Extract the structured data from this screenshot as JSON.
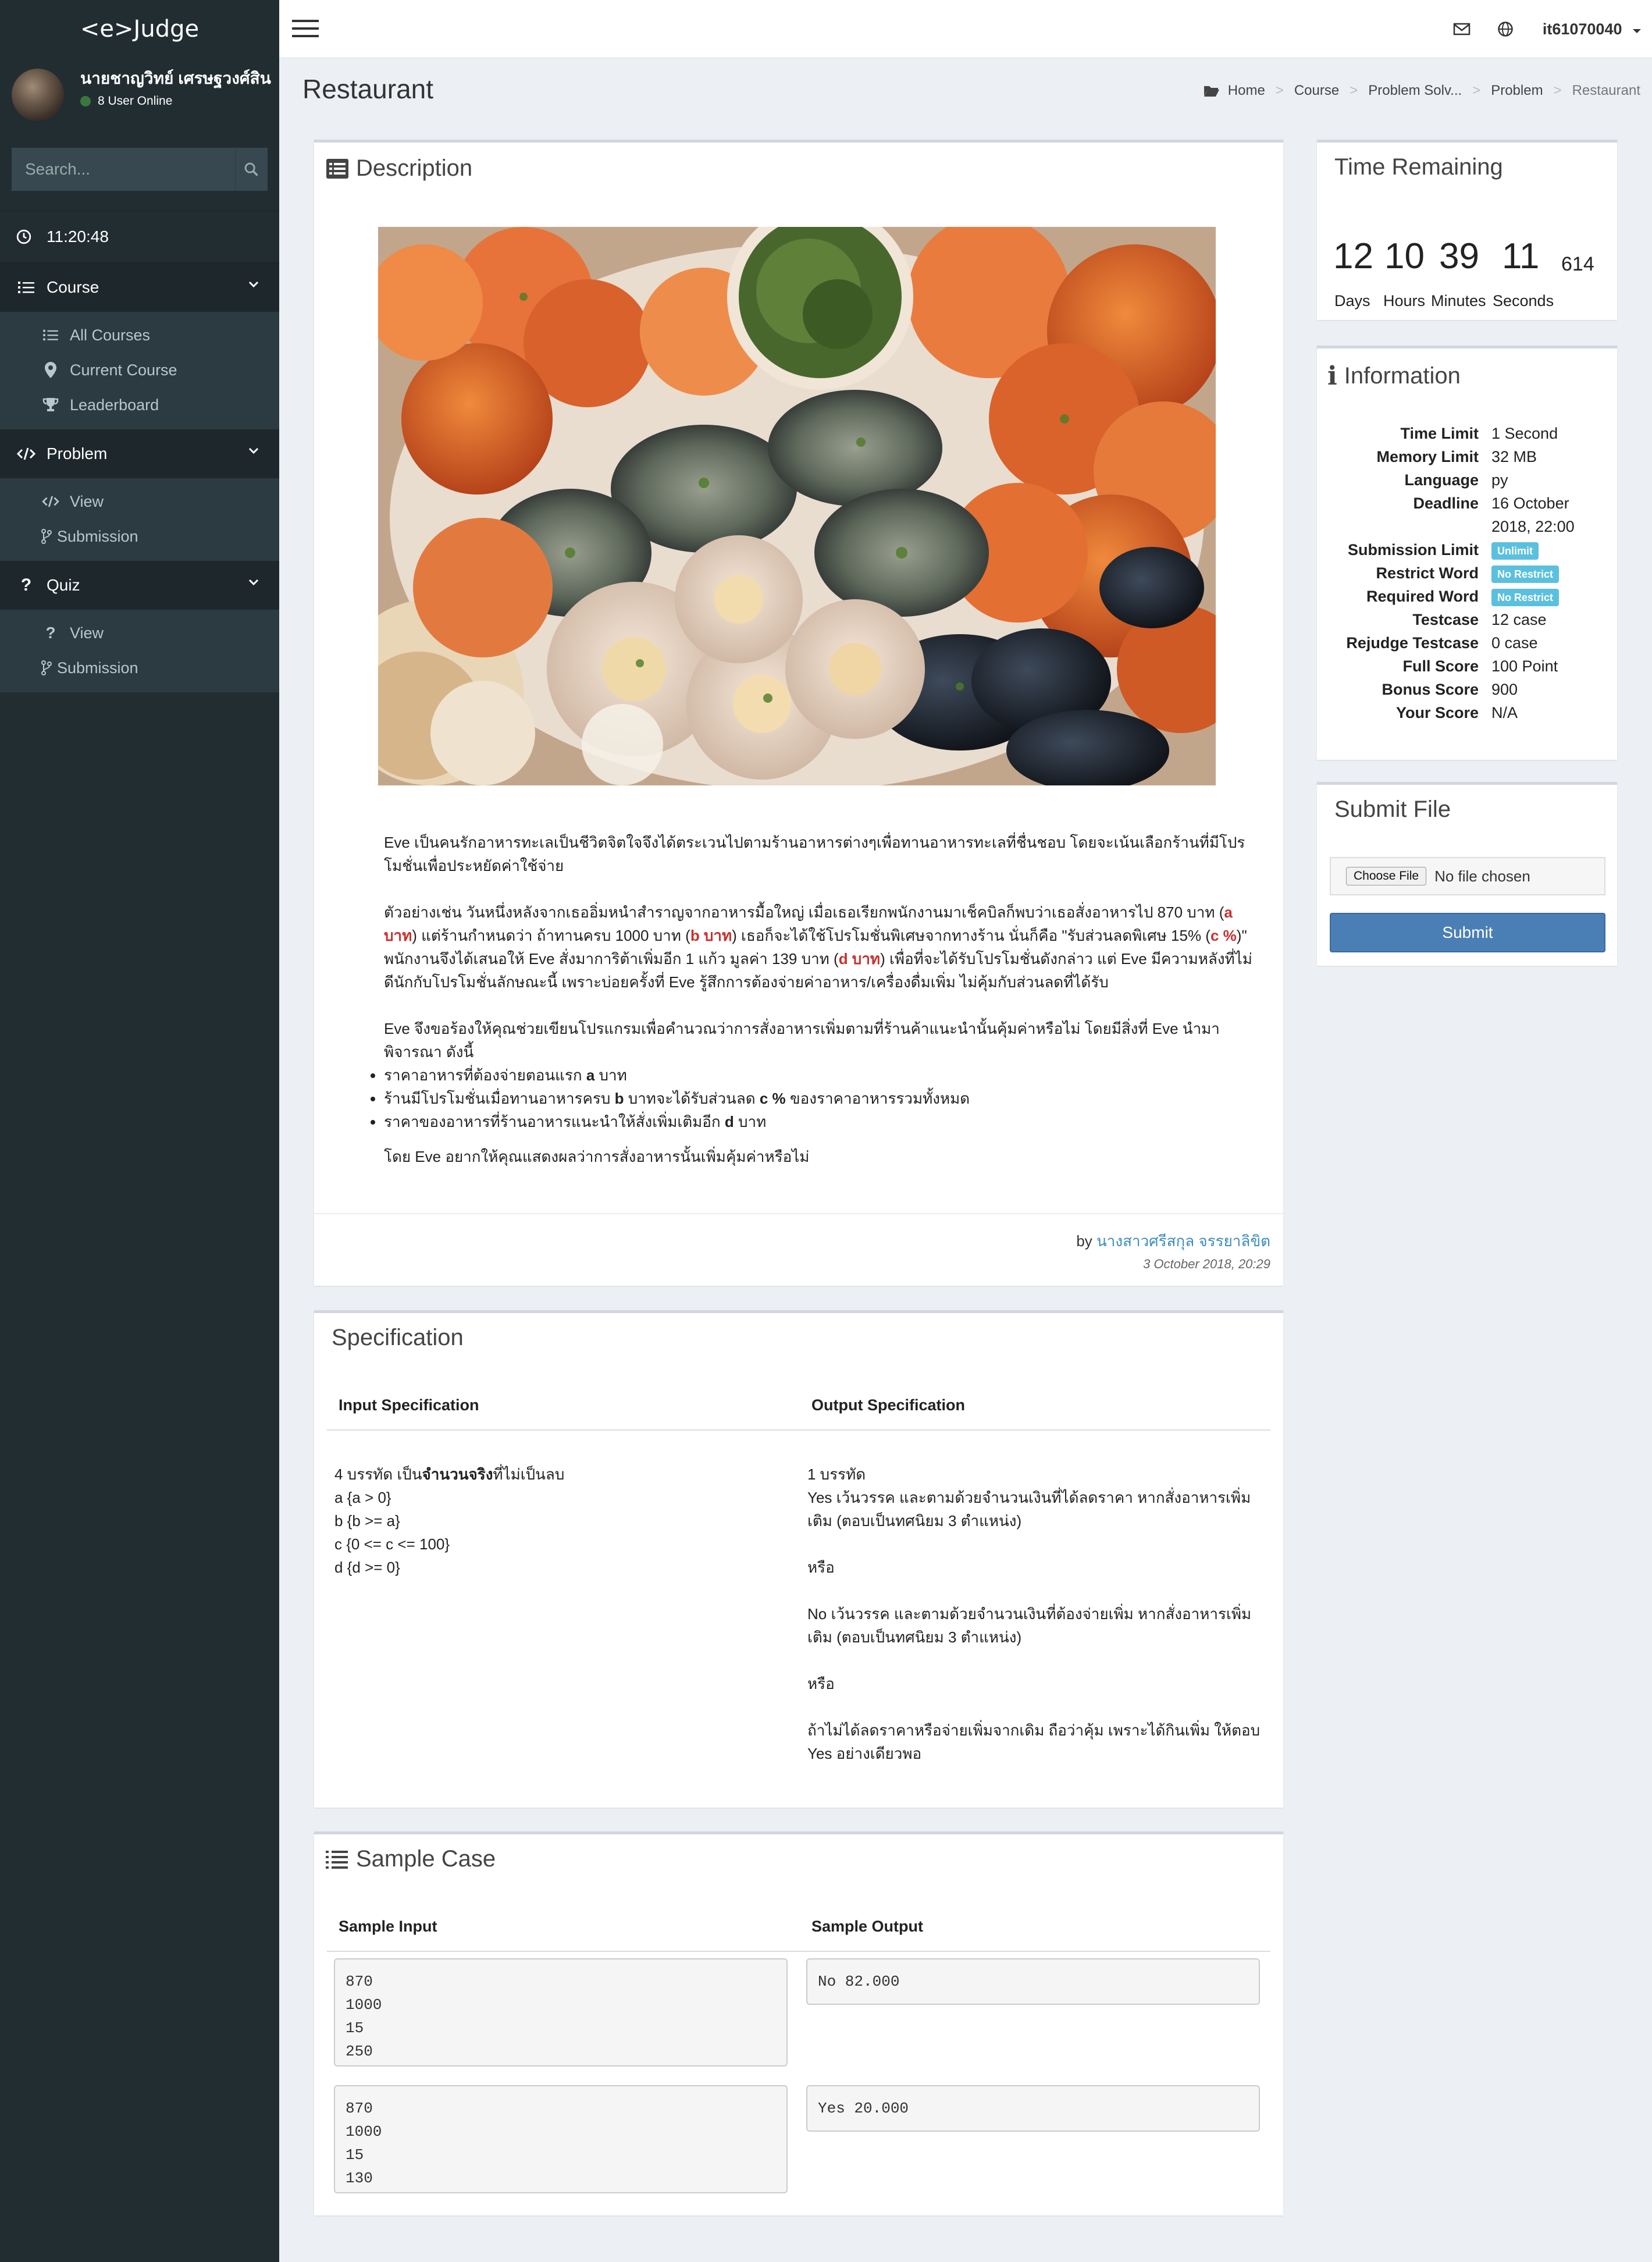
{
  "app": {
    "brand": "<e>Judge"
  },
  "sidebar": {
    "user_name": "นายชาญวิทย์ เศรษฐวงศ์สิน",
    "online": "8 User Online",
    "search_placeholder": "Search...",
    "clock": "11:20:48",
    "sections": [
      {
        "label": "Course",
        "icon": "list-icon",
        "items": [
          {
            "label": "All Courses",
            "icon": "list-icon"
          },
          {
            "label": "Current Course",
            "icon": "map-marker-icon"
          },
          {
            "label": "Leaderboard",
            "icon": "trophy-icon"
          }
        ]
      },
      {
        "label": "Problem",
        "icon": "code-icon",
        "items": [
          {
            "label": "View",
            "icon": "code-icon"
          },
          {
            "label": "Submission",
            "icon": "code-fork-icon"
          }
        ]
      },
      {
        "label": "Quiz",
        "icon": "question-icon",
        "items": [
          {
            "label": "View",
            "icon": "question-icon"
          },
          {
            "label": "Submission",
            "icon": "code-fork-icon"
          }
        ]
      }
    ]
  },
  "topbar": {
    "username": "it61070040"
  },
  "page": {
    "title": "Restaurant",
    "breadcrumb": [
      "Home",
      "Course",
      "Problem Solv...",
      "Problem",
      "Restaurant"
    ]
  },
  "description": {
    "title": "Description",
    "p1": "Eve เป็นคนรักอาหารทะเลเป็นชีวิตจิตใจจึงได้ตระเวนไปตามร้านอาหารต่างๆเพื่อทานอาหารทะเลที่ชื่นชอบ โดยจะเน้นเลือกร้านที่มีโปรโมชั่นเพื่อประหยัดค่าใช้จ่าย",
    "p2_a": "ตัวอย่างเช่น วันหนึ่งหลังจากเธออิ่มหนำสำราญจากอาหารมื้อใหญ่ เมื่อเธอเรียกพนักงานมาเช็คบิลก็พบว่าเธอสั่งอาหารไป 870 บาท (",
    "p2_red1": "a บาท",
    "p2_b": ") แต่ร้านกำหนดว่า ถ้าทานครบ 1000 บาท (",
    "p2_red2": "b บาท",
    "p2_c": ") เธอก็จะได้ใช้โปรโมชั่นพิเศษจากทางร้าน นั่นก็คือ \"รับส่วนลดพิเศษ 15% (",
    "p2_red3": "c %",
    "p2_d": ")\" พนักงานจึงได้เสนอให้ Eve สั่งมาการิต้าเพิ่มอีก 1 แก้ว มูลค่า 139 บาท (",
    "p2_red4": "d บาท",
    "p2_e": ") เพื่อที่จะได้รับโปรโมชั่นดังกล่าว แต่ Eve มีความหลังที่ไม่ดีนักกับโปรโมชั่นลักษณะนี้ เพราะบ่อยครั้งที่ Eve รู้สึกการต้องจ่ายค่าอาหาร/เครื่องดื่มเพิ่ม ไม่คุ้มกับส่วนลดที่ได้รับ",
    "p3": "Eve จึงขอร้องให้คุณช่วยเขียนโปรแกรมเพื่อคำนวณว่าการสั่งอาหารเพิ่มตามที่ร้านค้าแนะนำนั้นคุ้มค่าหรือไม่ โดยมีสิ่งที่ Eve นำมาพิจารณา ดังนี้",
    "bullets": [
      {
        "pre": "ราคาอาหารที่ต้องจ่ายตอนแรก ",
        "bold": "a",
        "post": " บาท"
      },
      {
        "pre": "ร้านมีโปรโมชั่นเมื่อทานอาหารครบ ",
        "bold": "b",
        "mid": " บาทจะได้รับส่วนลด ",
        "bold2": "c %",
        "post": " ของราคาอาหารรวมทั้งหมด"
      },
      {
        "pre": "ราคาของอาหารที่ร้านอาหารแนะนำให้สั่งเพิ่มเติมอีก ",
        "bold": "d",
        "post": " บาท"
      }
    ],
    "p4": "โดย Eve อยากให้คุณแสดงผลว่าการสั่งอาหารนั้นเพิ่มคุ้มค่าหรือไม่",
    "author_prefix": "by ",
    "author": "นางสาวศรีสกุล จรรยาลิขิต",
    "date": "3 October 2018, 20:29"
  },
  "specification": {
    "title": "Specification",
    "input_head": "Input Specification",
    "output_head": "Output Specification",
    "input_lines": {
      "l1_pre": "4 บรรทัด เป็น",
      "l1_bold": "จำนวนจริง",
      "l1_post": "ที่ไม่เป็นลบ",
      "l2": "a {a > 0}",
      "l3": "b {b >= a}",
      "l4": "c {0 <= c <= 100}",
      "l5": "d {d >= 0}"
    },
    "output_lines": {
      "o1": "1 บรรทัด",
      "o2": "Yes เว้นวรรค และตามด้วยจำนวนเงินที่ได้ลดราคา หากสั่งอาหารเพิ่มเติม (ตอบเป็นทศนิยม 3 ตำแหน่ง)",
      "o3": "หรือ",
      "o4": "No เว้นวรรค และตามด้วยจำนวนเงินที่ต้องจ่ายเพิ่ม หากสั่งอาหารเพิ่มเติม (ตอบเป็นทศนิยม 3 ตำแหน่ง)",
      "o5": "หรือ",
      "o6": "ถ้าไม่ได้ลดราคาหรือจ่ายเพิ่มจากเดิม ถือว่าคุ้ม เพราะได้กินเพิ่ม ให้ตอบ Yes อย่างเดียวพอ"
    }
  },
  "sample": {
    "title": "Sample Case",
    "input_head": "Sample Input",
    "output_head": "Sample Output",
    "cases": [
      {
        "input": "870\n1000\n15\n250",
        "output": "No 82.000"
      },
      {
        "input": "870\n1000\n15\n130",
        "output": "Yes 20.000"
      }
    ]
  },
  "time_remaining": {
    "title": "Time Remaining",
    "days": "12",
    "hours": "10",
    "minutes": "39",
    "seconds": "11",
    "ms": "614",
    "days_label": "Days",
    "hours_label": "Hours",
    "minutes_label": "Minutes",
    "seconds_label": "Seconds"
  },
  "information": {
    "title": "Information",
    "rows": [
      {
        "k": "Time Limit",
        "v": "1 Second"
      },
      {
        "k": "Memory Limit",
        "v": "32 MB"
      },
      {
        "k": "Language",
        "v": "py"
      },
      {
        "k": "Deadline",
        "v": "16 October 2018, 22:00"
      },
      {
        "k": "Submission Limit",
        "badge": "Unlimit"
      },
      {
        "k": "Restrict Word",
        "badge": "No Restrict"
      },
      {
        "k": "Required Word",
        "badge": "No Restrict"
      },
      {
        "k": "Testcase",
        "v": "12 case"
      },
      {
        "k": "Rejudge Testcase",
        "v": "0 case"
      },
      {
        "k": "Full Score",
        "v": "100 Point"
      },
      {
        "k": "Bonus Score",
        "v": "900"
      },
      {
        "k": "Your Score",
        "v": "N/A"
      }
    ]
  },
  "submit": {
    "title": "Submit File",
    "choose": "Choose File",
    "no_file": "No file chosen",
    "button": "Submit"
  },
  "colors": {
    "sidebar": "#222d32",
    "accent": "#3c8dbc",
    "submit_btn": "#4a7fb5",
    "badge": "#5bc0de",
    "red": "#c9302c"
  }
}
